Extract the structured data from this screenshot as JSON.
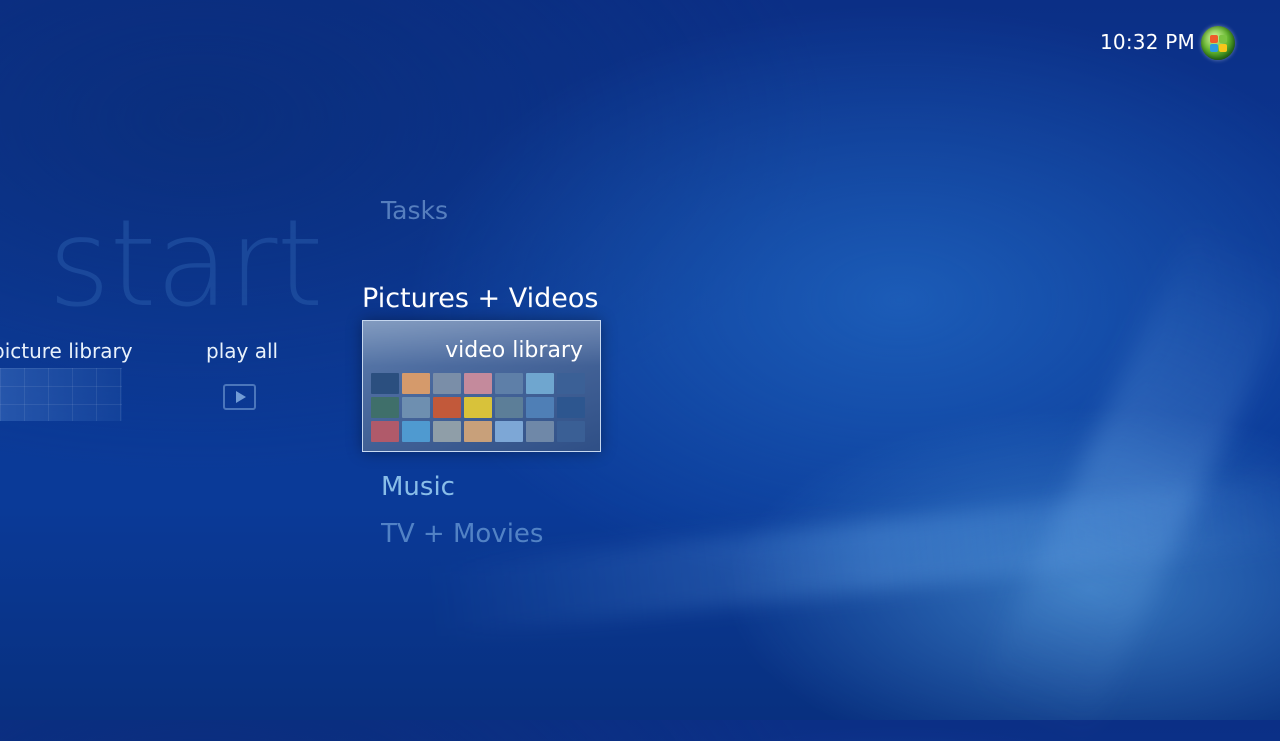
{
  "status": {
    "time": "10:32 PM"
  },
  "header": {
    "start_label": "start"
  },
  "menu": {
    "tasks": "Tasks",
    "pictures_videos": "Pictures + Videos",
    "music": "Music",
    "tv_movies": "TV + Movies"
  },
  "pictures_row": {
    "picture_library": "picture library",
    "play_all": "play all",
    "video_library": "video library"
  },
  "icons": {
    "windows_logo": "windows-logo-icon",
    "play": "play-icon"
  },
  "colors": {
    "background": "#0c3a97",
    "highlight_text": "#ffffff",
    "inactive_category": "#89bde8"
  }
}
